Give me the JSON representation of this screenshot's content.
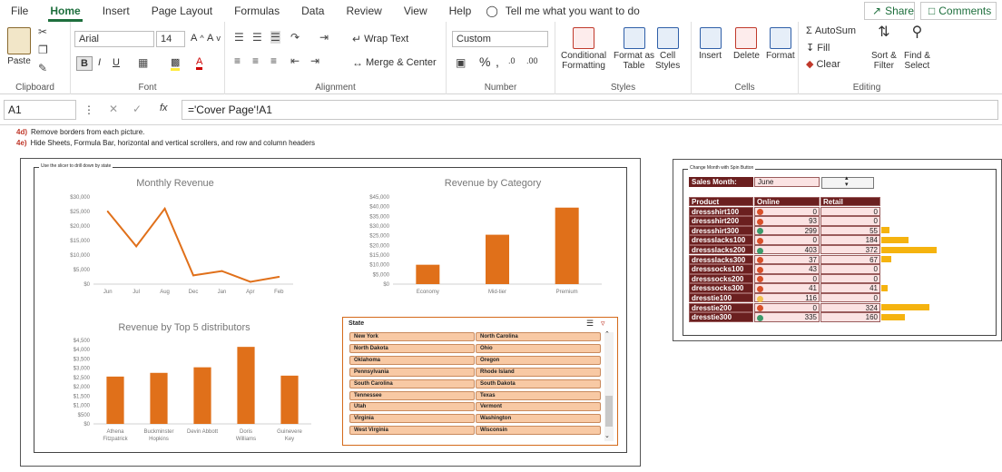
{
  "menu": {
    "items": [
      "File",
      "Home",
      "Insert",
      "Page Layout",
      "Formulas",
      "Data",
      "Review",
      "View",
      "Help"
    ],
    "tellme": "Tell me what you want to do",
    "share": "Share",
    "comments": "Comments"
  },
  "ribbon": {
    "clipboard": {
      "paste": "Paste",
      "label": "Clipboard"
    },
    "font": {
      "name": "Arial",
      "size": "14",
      "label": "Font"
    },
    "alignment": {
      "wrap_text": "Wrap Text",
      "merge_center": "Merge & Center",
      "label": "Alignment"
    },
    "number": {
      "format": "Custom",
      "label": "Number"
    },
    "styles": {
      "conditional": "Conditional",
      "formatting": "Formatting",
      "format_as": "Format as",
      "table": "Table",
      "cell": "Cell",
      "styles": "Styles",
      "label": "Styles"
    },
    "cells": {
      "insert": "Insert",
      "delete": "Delete",
      "format": "Format",
      "label": "Cells"
    },
    "editing": {
      "autosum": "AutoSum",
      "fill": "Fill",
      "clear": "Clear",
      "sort": "Sort &",
      "filter": "Filter",
      "find": "Find &",
      "select": "Select",
      "label": "Editing"
    }
  },
  "formula_bar": {
    "namebox": "A1",
    "formula": "='Cover Page'!A1"
  },
  "notes": [
    {
      "num": "4d)",
      "text": "Remove borders from each picture."
    },
    {
      "num": "4e)",
      "text": "Hide Sheets, Formula Bar, horizontal and vertical scrollers, and row and column headers"
    }
  ],
  "dashboard": {
    "frame_label": "Use the slicer to drill down by state",
    "monthly_title": "Monthly Revenue",
    "category_title": "Revenue by Category",
    "distributors_title": "Revenue by Top 5 distributors"
  },
  "chart_data": [
    {
      "type": "line",
      "title": "Monthly Revenue",
      "categories": [
        "Jun",
        "Jul",
        "Aug",
        "Dec",
        "Jan",
        "Apr",
        "Feb"
      ],
      "values": [
        25000,
        13000,
        26000,
        3000,
        4500,
        800,
        2500
      ],
      "ylim": [
        0,
        30000
      ],
      "yticks": [
        "$30,000",
        "$25,000",
        "$20,000",
        "$15,000",
        "$10,000",
        "$5,000",
        "$0"
      ],
      "color": "#e0701a"
    },
    {
      "type": "bar",
      "title": "Revenue by Category",
      "categories": [
        "Economy",
        "Mid-tier",
        "Premium"
      ],
      "values": [
        10000,
        25500,
        39500
      ],
      "ylim": [
        0,
        45000
      ],
      "yticks": [
        "$45,000",
        "$40,000",
        "$35,000",
        "$30,000",
        "$25,000",
        "$20,000",
        "$15,000",
        "$10,000",
        "$5,000",
        "$0"
      ],
      "color": "#e0701a"
    },
    {
      "type": "bar",
      "title": "Revenue by Top 5 distributors",
      "categories": [
        "Athena Fitzpatrick",
        "Buckminster Hopkins",
        "Devin Abbott",
        "Doris Williams",
        "Guinevere Key"
      ],
      "values": [
        2550,
        2750,
        3050,
        4150,
        2600
      ],
      "ylim": [
        0,
        4500
      ],
      "yticks": [
        "$4,500",
        "$4,000",
        "$3,500",
        "$3,000",
        "$2,500",
        "$2,000",
        "$1,500",
        "$1,000",
        "$500",
        "$0"
      ],
      "color": "#e0701a"
    }
  ],
  "slicer": {
    "title": "State",
    "left": [
      "New York",
      "North Dakota",
      "Oklahoma",
      "Pennsylvania",
      "South Carolina",
      "Tennessee",
      "Utah",
      "Virginia",
      "West Virginia"
    ],
    "right": [
      "North Carolina",
      "Ohio",
      "Oregon",
      "Rhode Island",
      "South Dakota",
      "Texas",
      "Vermont",
      "Washington",
      "Wisconsin"
    ]
  },
  "products": {
    "frame_label": "Change Month with Spin Button",
    "sales_month_label": "Sales Month:",
    "sales_month": "June",
    "headers": [
      "Product",
      "Online",
      "Retail"
    ],
    "rows": [
      {
        "name": "dressshirt100",
        "online": 0,
        "retail": 0,
        "dot": "#d9502a"
      },
      {
        "name": "dressshirt200",
        "online": 93,
        "retail": 0,
        "dot": "#d9502a"
      },
      {
        "name": "dressshirt300",
        "online": 299,
        "retail": 55,
        "dot": "#3c9a6a"
      },
      {
        "name": "dressslacks100",
        "online": 0,
        "retail": 184,
        "dot": "#d9502a"
      },
      {
        "name": "dressslacks200",
        "online": 403,
        "retail": 372,
        "dot": "#3c9a6a"
      },
      {
        "name": "dressslacks300",
        "online": 37,
        "retail": 67,
        "dot": "#d9502a"
      },
      {
        "name": "dresssocks100",
        "online": 43,
        "retail": 0,
        "dot": "#d9502a"
      },
      {
        "name": "dresssocks200",
        "online": 0,
        "retail": 0,
        "dot": "#d9502a"
      },
      {
        "name": "dresssocks300",
        "online": 41,
        "retail": 41,
        "dot": "#d9502a"
      },
      {
        "name": "dresstie100",
        "online": 116,
        "retail": 0,
        "dot": "#f2c14e"
      },
      {
        "name": "dresstie200",
        "online": 0,
        "retail": 324,
        "dot": "#d9502a"
      },
      {
        "name": "dresstie300",
        "online": 335,
        "retail": 160,
        "dot": "#3c9a6a"
      }
    ],
    "bar_max": 403,
    "bar_color": "#f5b30f"
  }
}
